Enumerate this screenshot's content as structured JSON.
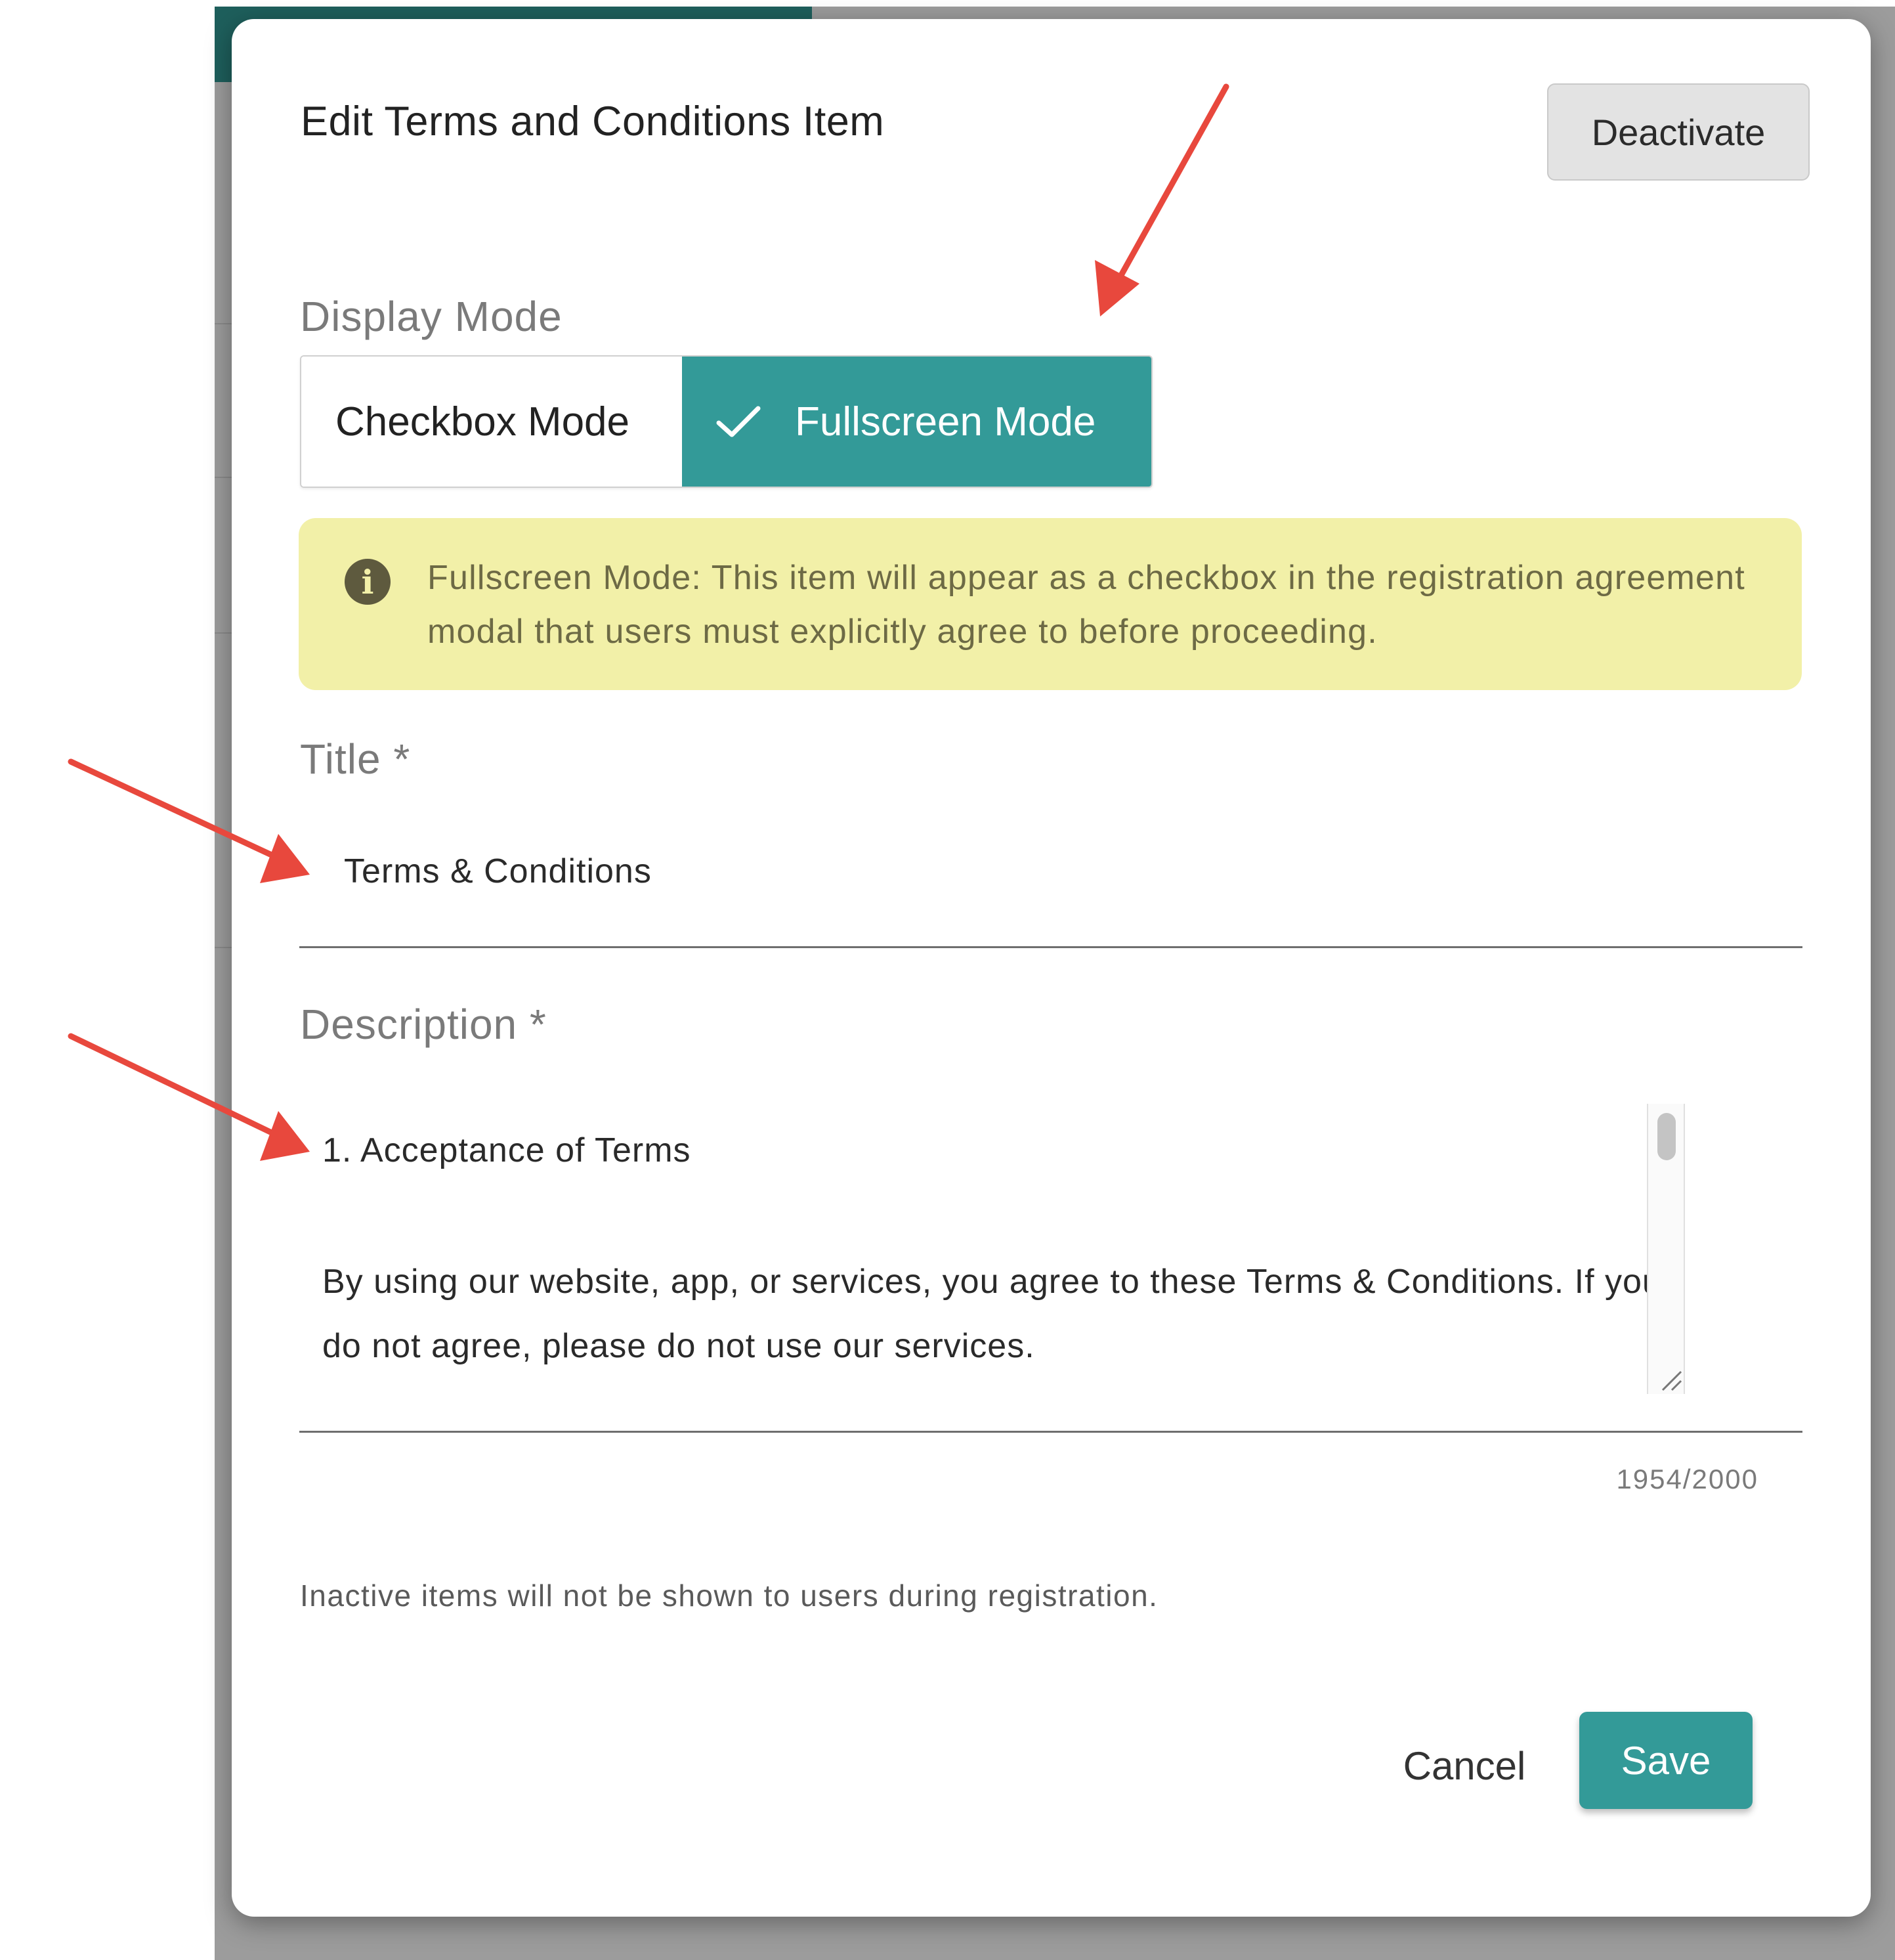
{
  "dialog": {
    "title": "Edit Terms and Conditions Item",
    "deactivate_label": "Deactivate"
  },
  "display_mode": {
    "label": "Display Mode",
    "options": [
      {
        "label": "Checkbox Mode",
        "selected": false
      },
      {
        "label": "Fullscreen Mode",
        "selected": true
      }
    ]
  },
  "info": {
    "icon": "info-icon",
    "text": "Fullscreen Mode: This item will appear as a checkbox in the registration agreement modal that users must explicitly agree to before proceeding."
  },
  "title_field": {
    "label": "Title *",
    "value": "Terms & Conditions"
  },
  "description_field": {
    "label": "Description *",
    "heading": "1. Acceptance of Terms",
    "body": "By using our website, app, or services, you agree to these Terms & Conditions. If you do not agree, please do not use our services.",
    "counter": "1954/2000"
  },
  "hint": "Inactive items will not be shown to users during registration.",
  "actions": {
    "cancel_label": "Cancel",
    "save_label": "Save"
  },
  "colors": {
    "accent": "#339a98",
    "info_bg": "#f2f0a8",
    "annotation_arrow": "#e8483d"
  }
}
